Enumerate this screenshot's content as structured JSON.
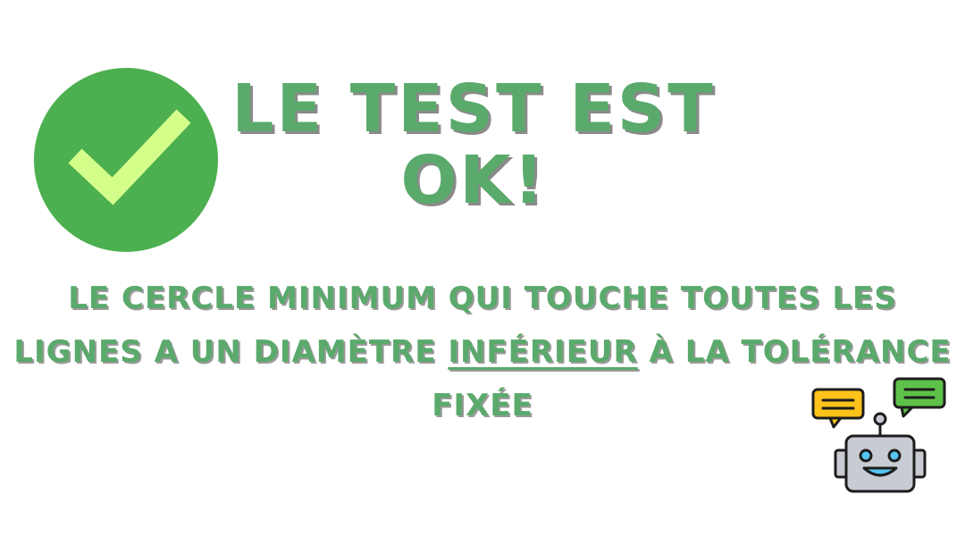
{
  "headline": {
    "line1": "LE TEST EST",
    "line2": "OK!"
  },
  "message": {
    "line1": "LE CERCLE MINIMUM QUI TOUCHE TOUTES LES",
    "line2_before": "LIGNES A UN DIAMÈTRE ",
    "line2_emphasis": "INFÉRIEUR",
    "line2_after": " À LA TOLÉRANCE",
    "line3": "FIXÉE"
  },
  "icons": {
    "badge": "check-icon",
    "mascot": "robot-icon",
    "bubbles": [
      "speech-bubble-yellow-icon",
      "speech-bubble-green-icon"
    ]
  },
  "colors": {
    "badge_green": "#4caf50",
    "check_lime": "#d4fe8a",
    "text_green": "#5aaa6b",
    "bubble_yellow": "#ffc21a",
    "bubble_green": "#5ec24a",
    "robot_gray": "#c8ccd2",
    "robot_eye": "#55c6f2"
  }
}
